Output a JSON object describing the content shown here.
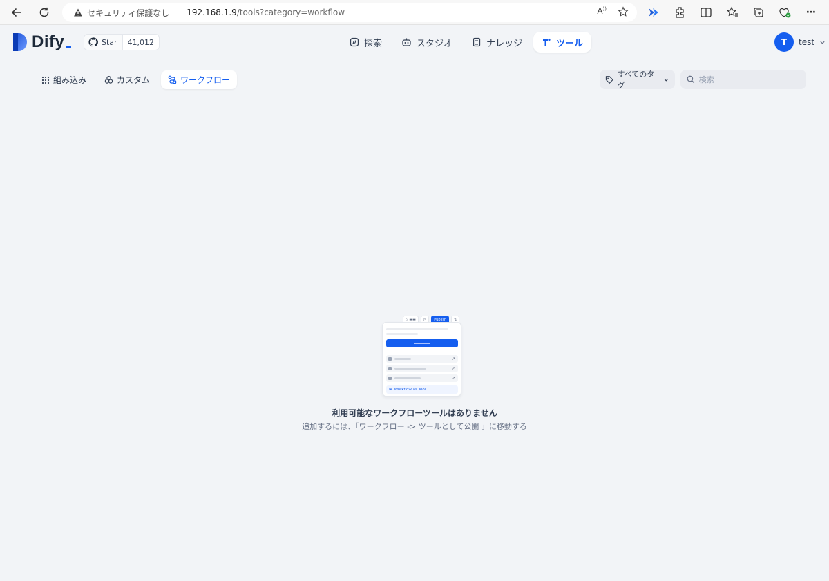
{
  "browser": {
    "security_warning": "セキュリティ保護なし",
    "url_host": "192.168.1.9",
    "url_path": "/tools?category=workflow"
  },
  "app": {
    "logo_text": "Dify",
    "github": {
      "star_label": "Star",
      "star_count": "41,012"
    },
    "nav": [
      {
        "label": "探索",
        "icon": "compass-icon"
      },
      {
        "label": "スタジオ",
        "icon": "robot-icon"
      },
      {
        "label": "ナレッジ",
        "icon": "book-icon"
      },
      {
        "label": "ツール",
        "icon": "tool-icon",
        "active": true
      }
    ],
    "user": {
      "initial": "T",
      "name": "test"
    }
  },
  "tools": {
    "categories": [
      {
        "label": "組み込み",
        "icon": "grid-icon"
      },
      {
        "label": "カスタム",
        "icon": "custom-icon"
      },
      {
        "label": "ワークフロー",
        "icon": "workflow-icon",
        "active": true
      }
    ],
    "tag_filter_label": "すべてのタグ",
    "search_placeholder": "検索"
  },
  "empty_state": {
    "title": "利用可能なワークフローツールはありません",
    "description": "追加するには、「ワークフロー -> ツールとして公開 」に移動する",
    "illustration": {
      "publish_label": "Publish",
      "workflow_as_tool_label": "Workflow as Tool"
    }
  },
  "colors": {
    "accent": "#155eef",
    "background": "#f2f4f7"
  }
}
